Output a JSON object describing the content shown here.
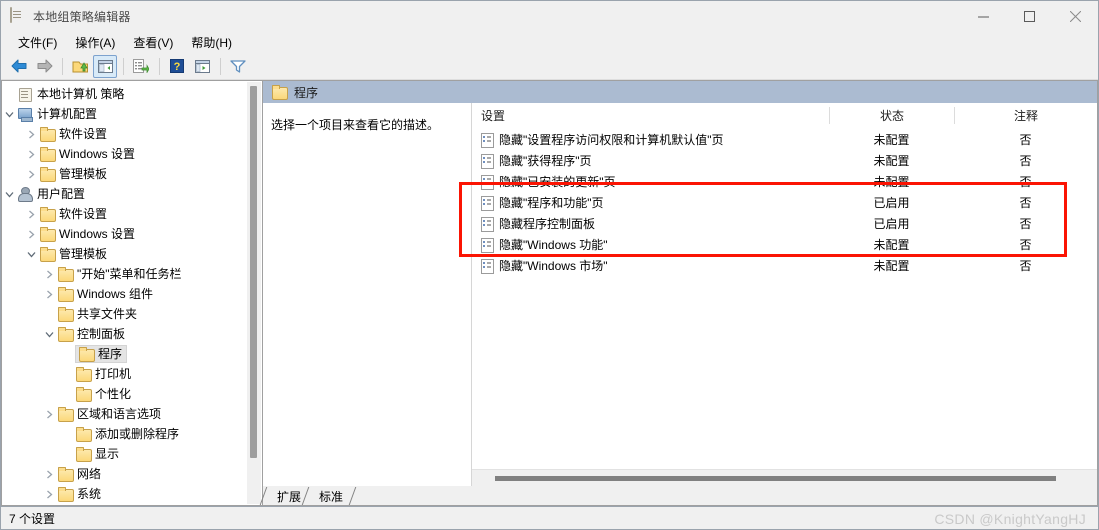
{
  "window": {
    "title": "本地组策略编辑器",
    "icon": "scroll-icon",
    "controls": {
      "minimize": "—",
      "maximize": "□",
      "close": "✕"
    }
  },
  "menubar": [
    {
      "label": "文件(F)",
      "name": "menu-file"
    },
    {
      "label": "操作(A)",
      "name": "menu-action"
    },
    {
      "label": "查看(V)",
      "name": "menu-view"
    },
    {
      "label": "帮助(H)",
      "name": "menu-help"
    }
  ],
  "toolbar": [
    {
      "name": "back-icon",
      "title": "后退"
    },
    {
      "name": "forward-icon",
      "title": "前进"
    },
    {
      "name": "up-folder-icon",
      "title": "向上"
    },
    {
      "name": "show-tree-icon",
      "title": "显示/隐藏控制台树",
      "selected": true
    },
    {
      "name": "export-list-icon",
      "title": "导出列表"
    },
    {
      "name": "help-icon",
      "title": "帮助"
    },
    {
      "name": "properties-icon",
      "title": "属性"
    },
    {
      "name": "filter-icon",
      "title": "筛选器"
    }
  ],
  "tree": {
    "root": {
      "label": "本地计算机 策略",
      "icon": "scroll-icon"
    },
    "items": [
      {
        "label": "计算机配置",
        "icon": "computer-icon",
        "indent": 1,
        "twisty": "expanded"
      },
      {
        "label": "软件设置",
        "icon": "folder-icon",
        "indent": 2,
        "twisty": "collapsed"
      },
      {
        "label": "Windows 设置",
        "icon": "folder-icon",
        "indent": 2,
        "twisty": "collapsed"
      },
      {
        "label": "管理模板",
        "icon": "folder-icon",
        "indent": 2,
        "twisty": "collapsed"
      },
      {
        "label": "用户配置",
        "icon": "user-icon",
        "indent": 1,
        "twisty": "expanded"
      },
      {
        "label": "软件设置",
        "icon": "folder-icon",
        "indent": 2,
        "twisty": "collapsed"
      },
      {
        "label": "Windows 设置",
        "icon": "folder-icon",
        "indent": 2,
        "twisty": "collapsed"
      },
      {
        "label": "管理模板",
        "icon": "folder-icon",
        "indent": 2,
        "twisty": "expanded"
      },
      {
        "label": "\"开始\"菜单和任务栏",
        "icon": "folder-icon",
        "indent": 3,
        "twisty": "collapsed"
      },
      {
        "label": "Windows 组件",
        "icon": "folder-icon",
        "indent": 3,
        "twisty": "collapsed"
      },
      {
        "label": "共享文件夹",
        "icon": "folder-icon",
        "indent": 3,
        "twisty": "none"
      },
      {
        "label": "控制面板",
        "icon": "folder-icon",
        "indent": 3,
        "twisty": "expanded"
      },
      {
        "label": "程序",
        "icon": "folder-icon",
        "indent": 4,
        "twisty": "none",
        "selected": true
      },
      {
        "label": "打印机",
        "icon": "folder-icon",
        "indent": 4,
        "twisty": "none"
      },
      {
        "label": "个性化",
        "icon": "folder-icon",
        "indent": 4,
        "twisty": "none"
      },
      {
        "label": "区域和语言选项",
        "icon": "folder-icon",
        "indent": 4,
        "twisty": "collapsed"
      },
      {
        "label": "添加或删除程序",
        "icon": "folder-icon",
        "indent": 4,
        "twisty": "none"
      },
      {
        "label": "显示",
        "icon": "folder-icon",
        "indent": 4,
        "twisty": "none"
      },
      {
        "label": "网络",
        "icon": "folder-icon",
        "indent": 3,
        "twisty": "collapsed"
      },
      {
        "label": "系统",
        "icon": "folder-icon",
        "indent": 3,
        "twisty": "collapsed"
      }
    ]
  },
  "pane": {
    "header_title": "程序",
    "header_icon": "folder-icon",
    "description": "选择一个项目来查看它的描述。"
  },
  "list": {
    "columns": {
      "setting": "设置",
      "state": "状态",
      "comment": "注释"
    },
    "rows": [
      {
        "setting": "隐藏\"设置程序访问权限和计算机默认值\"页",
        "state": "未配置",
        "comment": "否"
      },
      {
        "setting": "隐藏\"获得程序\"页",
        "state": "未配置",
        "comment": "否"
      },
      {
        "setting": "隐藏\"已安装的更新\"页",
        "state": "未配置",
        "comment": "否"
      },
      {
        "setting": "隐藏\"程序和功能\"页",
        "state": "已启用",
        "comment": "否"
      },
      {
        "setting": "隐藏程序控制面板",
        "state": "已启用",
        "comment": "否"
      },
      {
        "setting": "隐藏\"Windows 功能\"",
        "state": "未配置",
        "comment": "否"
      },
      {
        "setting": "隐藏\"Windows 市场\"",
        "state": "未配置",
        "comment": "否"
      }
    ]
  },
  "tabs": [
    {
      "label": "扩展",
      "name": "tab-extended",
      "active": false
    },
    {
      "label": "标准",
      "name": "tab-standard",
      "active": true
    }
  ],
  "statusbar": {
    "text": "7 个设置"
  },
  "watermark": {
    "text": "CSDN @KnightYangHJ"
  },
  "colors": {
    "pane_header": "#abbbd1",
    "annotation": "#fb1403",
    "selection": "#e4e4e4"
  }
}
